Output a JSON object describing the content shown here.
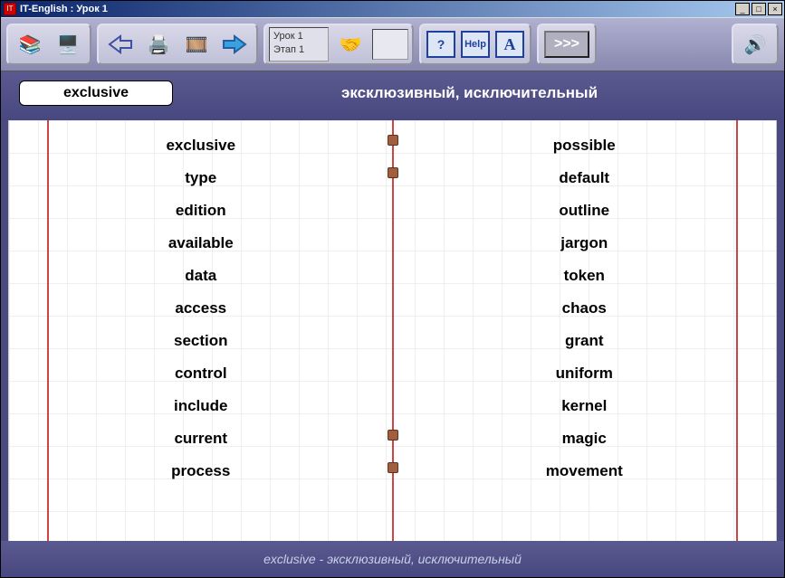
{
  "window": {
    "title": "IT-English : Урок 1"
  },
  "toolbar": {
    "lesson_line1": "Урок 1",
    "lesson_line2": "Этап 1",
    "help_q": "?",
    "help_label": "Help",
    "font_label": "A",
    "next_label": ">>>"
  },
  "header": {
    "word": "exclusive",
    "translation": "эксклюзивный, исключительный"
  },
  "left_words": [
    "exclusive",
    "type",
    "edition",
    "available",
    "data",
    "access",
    "section",
    "control",
    "include",
    "current",
    "process"
  ],
  "right_words": [
    "possible",
    "default",
    "outline",
    "jargon",
    "token",
    "chaos",
    "grant",
    "uniform",
    "kernel",
    "magic",
    "movement"
  ],
  "footer": {
    "text": "exclusive - эксклюзивный, исключительный"
  }
}
